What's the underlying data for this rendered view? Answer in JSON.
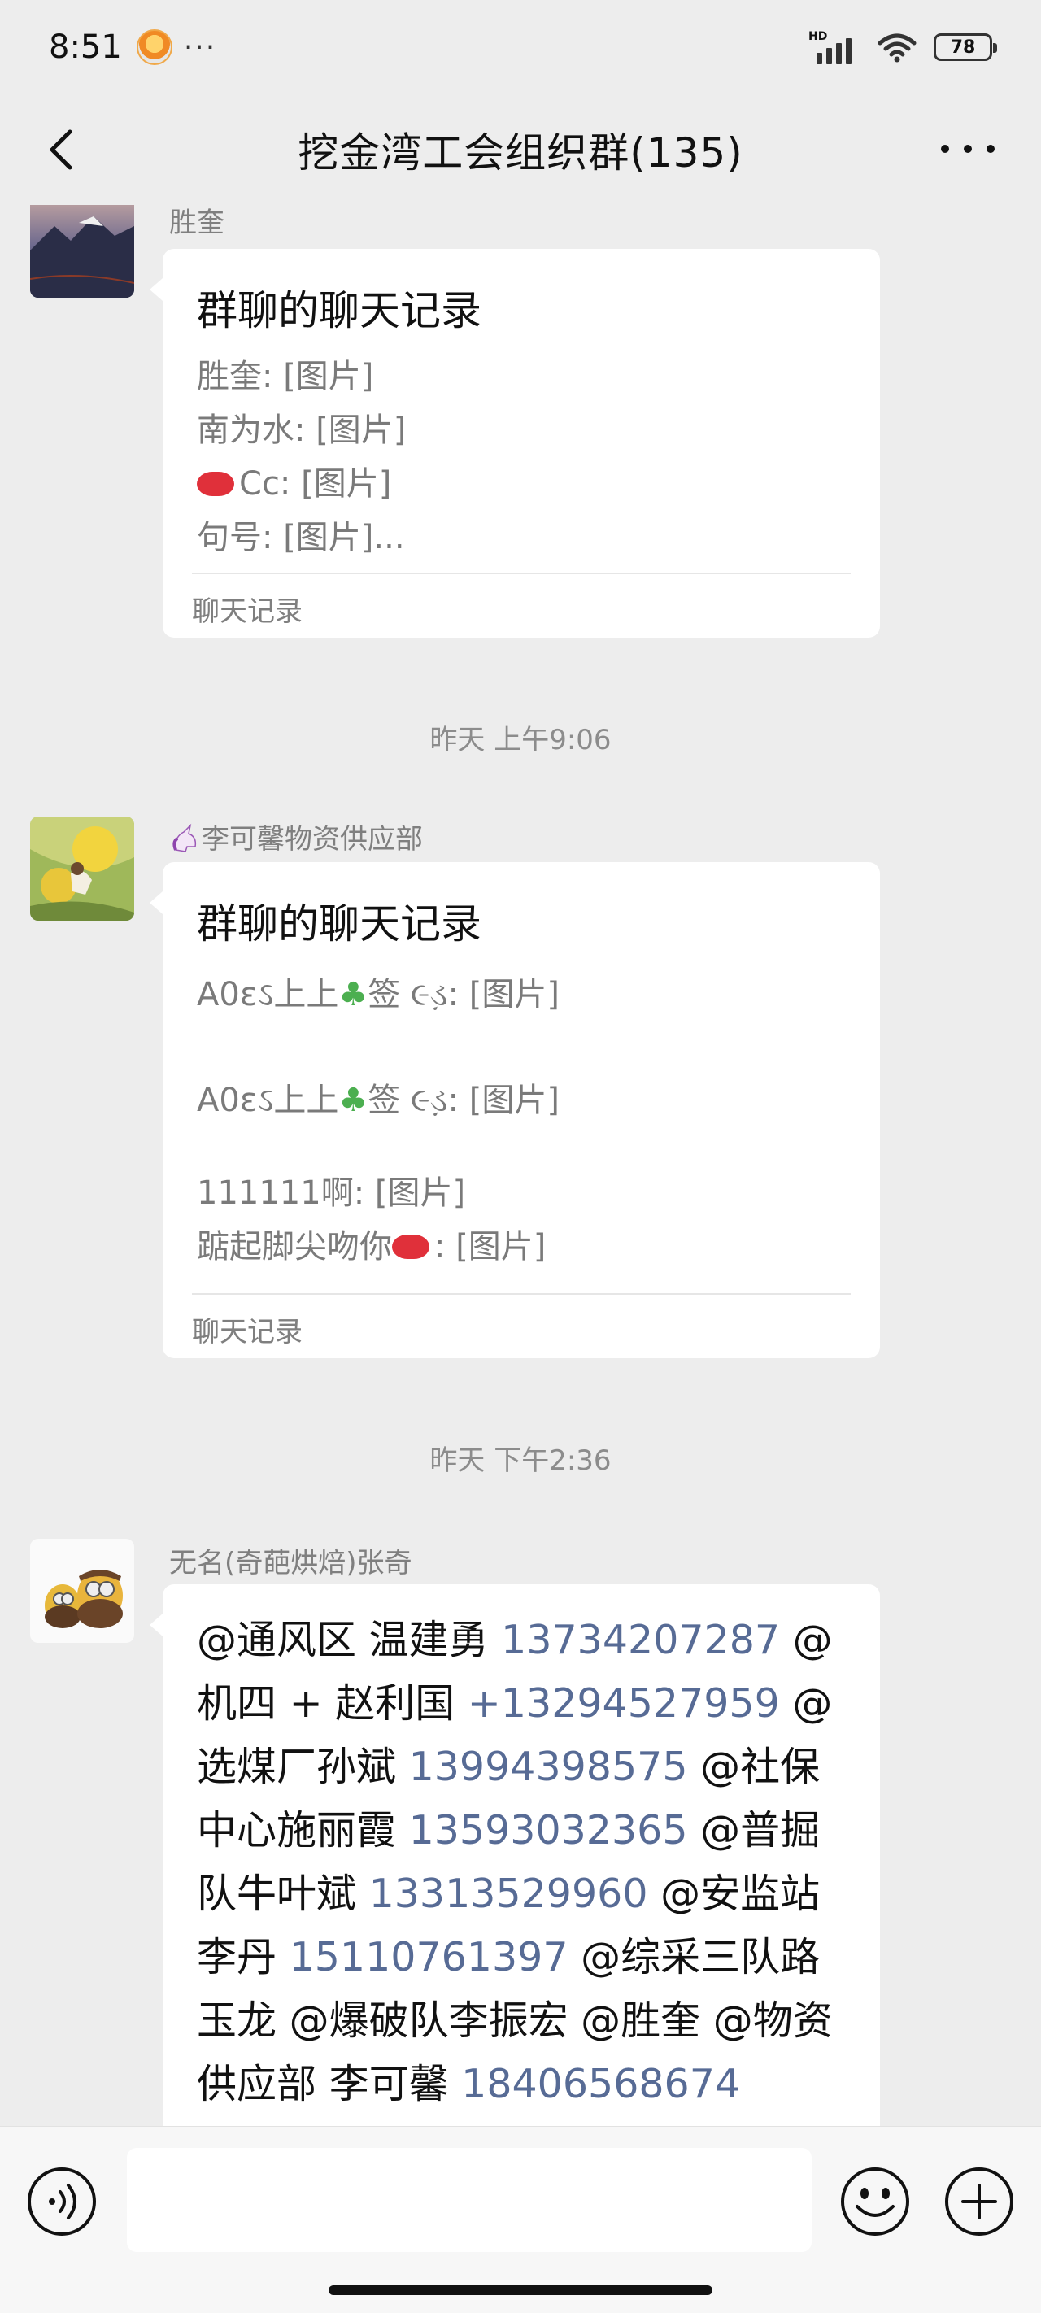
{
  "status_bar": {
    "time": "8:51",
    "more": "···",
    "network_label": "HD",
    "battery": "78"
  },
  "nav": {
    "title": "挖金湾工会组织群(135)"
  },
  "messages": [
    {
      "sender": "胜奎",
      "type": "chat_record",
      "title": "群聊的聊天记录",
      "lines": [
        "胜奎: [图片]",
        "南为水: [图片]",
        "Cc: [图片]",
        "句号: [图片]..."
      ],
      "footer": "聊天记录"
    },
    {
      "timestamp": "昨天 上午9:06"
    },
    {
      "sender": "李可馨物资供应部",
      "type": "chat_record",
      "title": "群聊的聊天记录",
      "lines": [
        "A0ɛઽ上上",
        "签 ૯ડ઼: [图片]",
        "A0ɛઽ上上",
        "签 ૯ડ઼: [图片]",
        "111111啊: [图片]",
        "踮起脚尖吻你",
        ": [图片]"
      ],
      "footer": "聊天记录"
    },
    {
      "timestamp": "昨天 下午2:36"
    },
    {
      "sender": "无名(奇葩烘焙)张奇",
      "type": "text",
      "segments": [
        "@通风区 温建勇 ",
        "13734207287",
        " @机四 + 赵利国 ",
        "+13294527959",
        " @选煤厂孙斌 ",
        "13994398575",
        " @社保中心施丽霞 ",
        "13593032365",
        " @普掘队牛叶斌 ",
        "13313529960",
        " @安监站 李丹 ",
        "15110761397",
        " @综采三队路玉龙 @爆破队李振宏 @胜奎 @物资供应部 李可馨 ",
        "18406568674"
      ]
    }
  ],
  "colors": {
    "background": "#ededed",
    "bubble": "#ffffff",
    "link": "#576b95",
    "meta_text": "#7f7f7f"
  },
  "icons": {
    "back": "chevron-left-icon",
    "more": "more-dots-icon",
    "voice": "voice-icon",
    "emoji": "emoji-icon",
    "plus": "plus-icon"
  }
}
